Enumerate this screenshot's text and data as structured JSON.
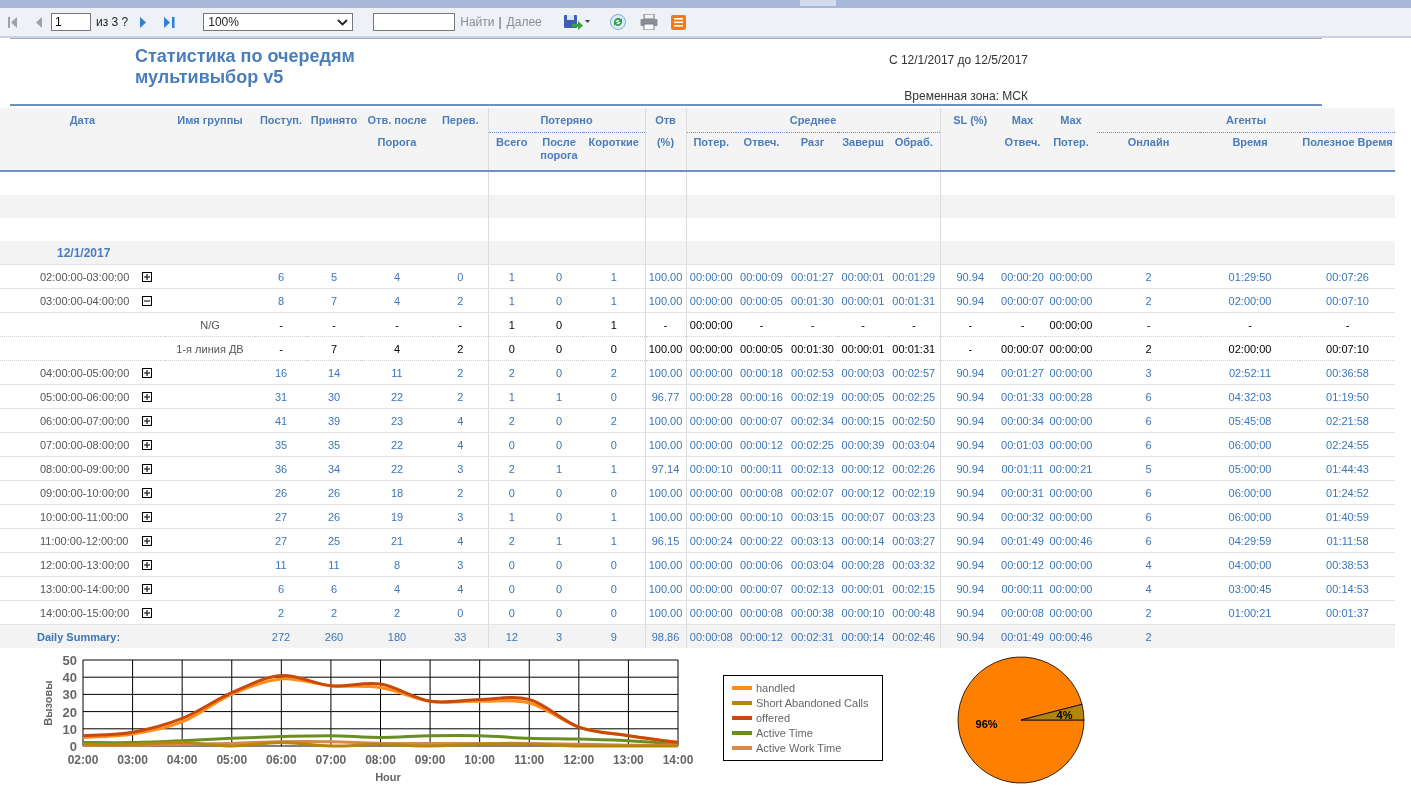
{
  "toolbar": {
    "page": "1",
    "page_count": "из 3 ?",
    "zoom": "100%",
    "find_label": "Найти",
    "separator": "|",
    "next_label": "Далее"
  },
  "report": {
    "title": "Статистика по очередям мультивыбор v5",
    "period": "С 12/1/2017 до 12/5/2017",
    "timezone": "Временная зона: МСК"
  },
  "header": [
    {
      "label": "Дата"
    },
    {
      "label": "Имя группы"
    },
    {
      "label": "Поступ."
    },
    {
      "label": "Принято"
    },
    {
      "label": "Отв. после",
      "sub": "Порога"
    },
    {
      "label": "Перев."
    },
    {
      "group": "Потеряно",
      "columns": [
        "Всего",
        "После порога",
        "Короткие"
      ]
    },
    {
      "label": "Отв",
      "sub": "(%)"
    },
    {
      "group": "Среднее",
      "columns": [
        "Потер.",
        "Отвеч.",
        "Разг",
        "Заверш",
        "Обраб."
      ]
    },
    {
      "label": "SL (%)"
    },
    {
      "label": "Max",
      "sub": "Отвеч."
    },
    {
      "label": "Max",
      "sub": "Потер."
    },
    {
      "group": "Агенты",
      "columns": [
        "Онлайн",
        "Время",
        "Полезное Время"
      ]
    }
  ],
  "rows": [
    {
      "kind": "blank"
    },
    {
      "kind": "band"
    },
    {
      "kind": "blank"
    },
    {
      "kind": "date",
      "label": "12/1/2017"
    },
    {
      "kind": "hour",
      "time": "02:00:00-03:00:00",
      "expanded": false,
      "values": [
        "6",
        "5",
        "4",
        "0",
        "1",
        "0",
        "1",
        "100.00",
        "00:00:00",
        "00:00:09",
        "00:01:27",
        "00:00:01",
        "00:01:29",
        "90.94",
        "00:00:20",
        "00:00:00",
        "2",
        "01:29:50",
        "00:07:26"
      ]
    },
    {
      "kind": "hour",
      "time": "03:00:00-04:00:00",
      "expanded": true,
      "values": [
        "8",
        "7",
        "4",
        "2",
        "1",
        "0",
        "1",
        "100.00",
        "00:00:00",
        "00:00:05",
        "00:01:30",
        "00:00:01",
        "00:01:31",
        "90.94",
        "00:00:07",
        "00:00:00",
        "2",
        "02:00:00",
        "00:07:10"
      ]
    },
    {
      "kind": "group",
      "group": "N/G",
      "values": [
        "-",
        "-",
        "-",
        "-",
        "1",
        "0",
        "1",
        "-",
        "00:00:00",
        "-",
        "-",
        "-",
        "-",
        "-",
        "-",
        "00:00:00",
        "-",
        "-",
        "-"
      ]
    },
    {
      "kind": "group",
      "group": "1-я линия ДВ",
      "values": [
        "-",
        "7",
        "4",
        "2",
        "0",
        "0",
        "0",
        "100.00",
        "00:00:00",
        "00:00:05",
        "00:01:30",
        "00:00:01",
        "00:01:31",
        "-",
        "00:00:07",
        "00:00:00",
        "2",
        "02:00:00",
        "00:07:10"
      ]
    },
    {
      "kind": "hour",
      "time": "04:00:00-05:00:00",
      "expanded": false,
      "values": [
        "16",
        "14",
        "11",
        "2",
        "2",
        "0",
        "2",
        "100.00",
        "00:00:00",
        "00:00:18",
        "00:02:53",
        "00:00:03",
        "00:02:57",
        "90.94",
        "00:01:27",
        "00:00:00",
        "3",
        "02:52:11",
        "00:36:58"
      ]
    },
    {
      "kind": "hour",
      "time": "05:00:00-06:00:00",
      "expanded": false,
      "values": [
        "31",
        "30",
        "22",
        "2",
        "1",
        "1",
        "0",
        "96.77",
        "00:00:28",
        "00:00:16",
        "00:02:19",
        "00:00:05",
        "00:02:25",
        "90.94",
        "00:01:33",
        "00:00:28",
        "6",
        "04:32:03",
        "01:19:50"
      ]
    },
    {
      "kind": "hour",
      "time": "06:00:00-07:00:00",
      "expanded": false,
      "values": [
        "41",
        "39",
        "23",
        "4",
        "2",
        "0",
        "2",
        "100.00",
        "00:00:00",
        "00:00:07",
        "00:02:34",
        "00:00:15",
        "00:02:50",
        "90.94",
        "00:00:34",
        "00:00:00",
        "6",
        "05:45:08",
        "02:21:58"
      ]
    },
    {
      "kind": "hour",
      "time": "07:00:00-08:00:00",
      "expanded": false,
      "values": [
        "35",
        "35",
        "22",
        "4",
        "0",
        "0",
        "0",
        "100.00",
        "00:00:00",
        "00:00:12",
        "00:02:25",
        "00:00:39",
        "00:03:04",
        "90.94",
        "00:01:03",
        "00:00:00",
        "6",
        "06:00:00",
        "02:24:55"
      ]
    },
    {
      "kind": "hour",
      "time": "08:00:00-09:00:00",
      "expanded": false,
      "values": [
        "36",
        "34",
        "22",
        "3",
        "2",
        "1",
        "1",
        "97.14",
        "00:00:10",
        "00:00:11",
        "00:02:13",
        "00:00:12",
        "00:02:26",
        "90.94",
        "00:01:11",
        "00:00:21",
        "5",
        "05:00:00",
        "01:44:43"
      ]
    },
    {
      "kind": "hour",
      "time": "09:00:00-10:00:00",
      "expanded": false,
      "values": [
        "26",
        "26",
        "18",
        "2",
        "0",
        "0",
        "0",
        "100.00",
        "00:00:00",
        "00:00:08",
        "00:02:07",
        "00:00:12",
        "00:02:19",
        "90.94",
        "00:00:31",
        "00:00:00",
        "6",
        "06:00:00",
        "01:24:52"
      ]
    },
    {
      "kind": "hour",
      "time": "10:00:00-11:00:00",
      "expanded": false,
      "values": [
        "27",
        "26",
        "19",
        "3",
        "1",
        "0",
        "1",
        "100.00",
        "00:00:00",
        "00:00:10",
        "00:03:15",
        "00:00:07",
        "00:03:23",
        "90.94",
        "00:00:32",
        "00:00:00",
        "6",
        "06:00:00",
        "01:40:59"
      ]
    },
    {
      "kind": "hour",
      "time": "11:00:00-12:00:00",
      "expanded": false,
      "values": [
        "27",
        "25",
        "21",
        "4",
        "2",
        "1",
        "1",
        "96.15",
        "00:00:24",
        "00:00:22",
        "00:03:13",
        "00:00:14",
        "00:03:27",
        "90.94",
        "00:01:49",
        "00:00:46",
        "6",
        "04:29:59",
        "01:11:58"
      ]
    },
    {
      "kind": "hour",
      "time": "12:00:00-13:00:00",
      "expanded": false,
      "values": [
        "11",
        "11",
        "8",
        "3",
        "0",
        "0",
        "0",
        "100.00",
        "00:00:00",
        "00:00:06",
        "00:03:04",
        "00:00:28",
        "00:03:32",
        "90.94",
        "00:00:12",
        "00:00:00",
        "4",
        "04:00:00",
        "00:38:53"
      ]
    },
    {
      "kind": "hour",
      "time": "13:00:00-14:00:00",
      "expanded": false,
      "values": [
        "6",
        "6",
        "4",
        "4",
        "0",
        "0",
        "0",
        "100.00",
        "00:00:00",
        "00:00:07",
        "00:02:13",
        "00:00:01",
        "00:02:15",
        "90.94",
        "00:00:11",
        "00:00:00",
        "4",
        "03:00:45",
        "00:14:53"
      ]
    },
    {
      "kind": "hour",
      "time": "14:00:00-15:00:00",
      "expanded": false,
      "values": [
        "2",
        "2",
        "2",
        "0",
        "0",
        "0",
        "0",
        "100.00",
        "00:00:00",
        "00:00:08",
        "00:00:38",
        "00:00:10",
        "00:00:48",
        "90.94",
        "00:00:08",
        "00:00:00",
        "2",
        "01:00:21",
        "00:01:37"
      ]
    }
  ],
  "summary": {
    "label": "Daily Summary:",
    "values": [
      "272",
      "260",
      "180",
      "33",
      "12",
      "3",
      "9",
      "98.86",
      "00:00:08",
      "00:00:12",
      "00:02:31",
      "00:00:14",
      "00:02:46",
      "90.94",
      "00:01:49",
      "00:00:46",
      "2"
    ]
  },
  "line_chart": {
    "chart_data": {
      "type": "line",
      "grid": true,
      "legend": "right",
      "xlabel": "Hour",
      "ylabel": "Вызовы",
      "x": [
        "02:00",
        "03:00",
        "04:00",
        "05:00",
        "06:00",
        "07:00",
        "08:00",
        "09:00",
        "10:00",
        "11:00",
        "12:00",
        "13:00",
        "14:00"
      ],
      "ylim": [
        0,
        50
      ],
      "yticks": [
        0,
        10,
        20,
        30,
        40,
        50
      ],
      "series": [
        {
          "name": "handled",
          "color": "#ff8c1a",
          "values": [
            5,
            7,
            14,
            30,
            39,
            35,
            34,
            26,
            26,
            25,
            11,
            6,
            2
          ]
        },
        {
          "name": "Short Abandoned Calls",
          "color": "#b8860b",
          "values": [
            1,
            1,
            2,
            0,
            2,
            0,
            1,
            0,
            1,
            1,
            0,
            0,
            0
          ]
        },
        {
          "name": "offered",
          "color": "#c84a08",
          "values": [
            6,
            8,
            16,
            31,
            41,
            35,
            36,
            26,
            27,
            27,
            11,
            6,
            2
          ]
        },
        {
          "name": "Active Time",
          "color": "#6b8e23",
          "values": [
            2,
            2,
            3,
            4.5,
            5.5,
            6,
            5,
            6,
            6,
            4.5,
            4,
            3,
            1
          ]
        },
        {
          "name": "Active Work Time",
          "color": "#d9894a",
          "values": [
            0.5,
            0.5,
            1,
            1.5,
            2.5,
            2.5,
            1.5,
            1.5,
            1.5,
            1.5,
            1,
            0.5,
            0.5
          ]
        }
      ]
    }
  },
  "pie_chart": {
    "chart_data": {
      "type": "pie",
      "values": [
        96,
        4
      ],
      "colors": [
        "#ff8000",
        "#b0860c"
      ],
      "value_labels": [
        "96%",
        "4%"
      ]
    }
  }
}
